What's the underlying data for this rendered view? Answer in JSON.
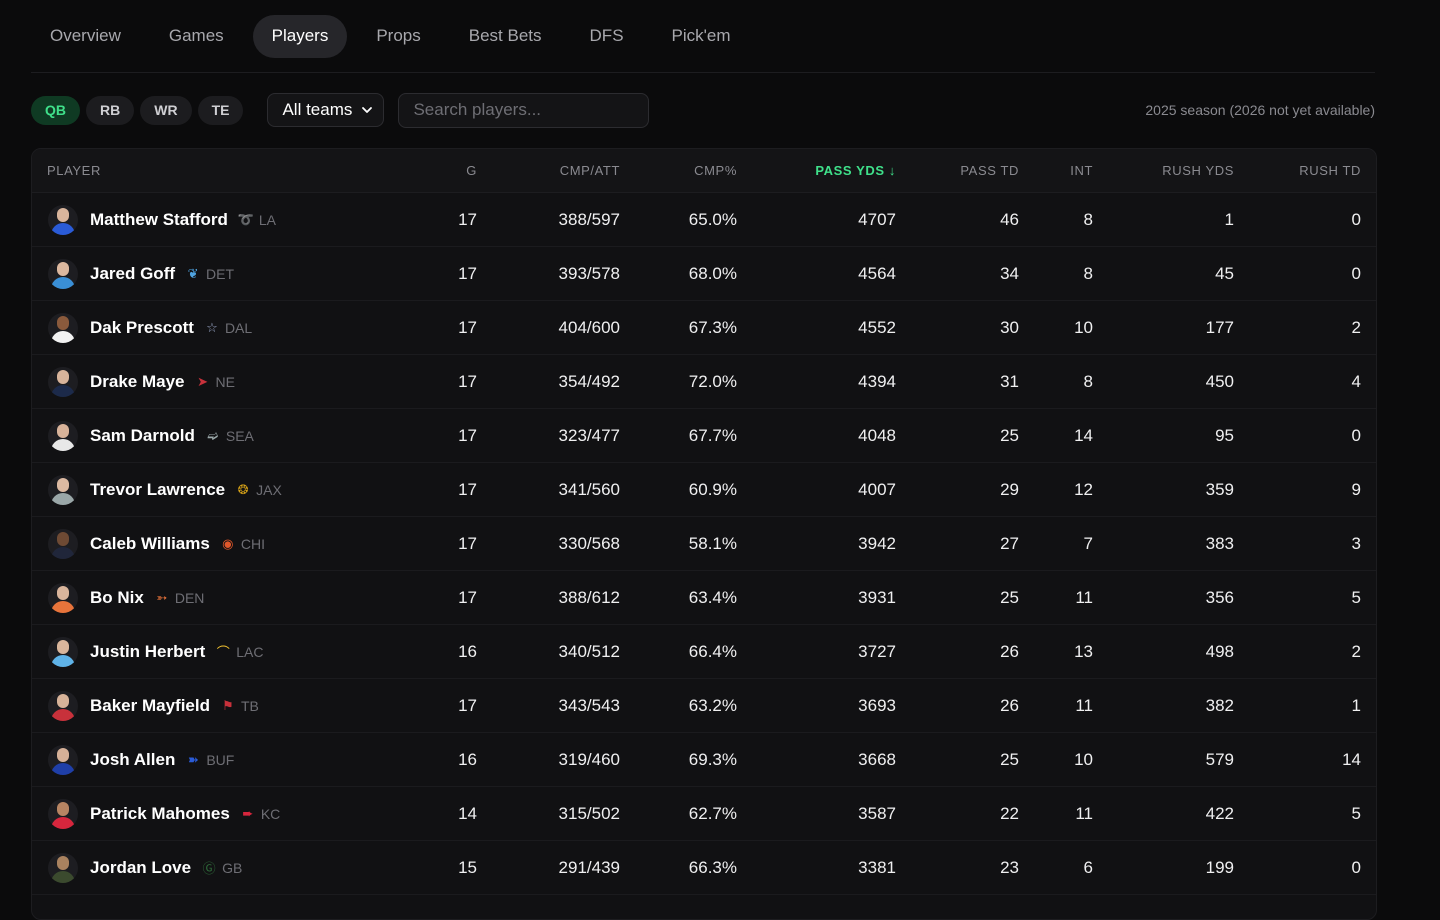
{
  "nav": {
    "tabs": [
      {
        "label": "Overview",
        "active": false
      },
      {
        "label": "Games",
        "active": false
      },
      {
        "label": "Players",
        "active": true
      },
      {
        "label": "Props",
        "active": false
      },
      {
        "label": "Best Bets",
        "active": false
      },
      {
        "label": "DFS",
        "active": false
      },
      {
        "label": "Pick'em",
        "active": false
      }
    ]
  },
  "filters": {
    "positions": [
      {
        "label": "QB",
        "active": true
      },
      {
        "label": "RB",
        "active": false
      },
      {
        "label": "WR",
        "active": false
      },
      {
        "label": "TE",
        "active": false
      }
    ],
    "team_select": "All teams",
    "search_placeholder": "Search players...",
    "season_note": "2025 season (2026 not yet available)"
  },
  "table": {
    "sort_indicator": "↓",
    "columns": [
      {
        "label": "PLAYER",
        "sorted": false
      },
      {
        "label": "G",
        "sorted": false
      },
      {
        "label": "CMP/ATT",
        "sorted": false
      },
      {
        "label": "CMP%",
        "sorted": false
      },
      {
        "label": "PASS YDS",
        "sorted": true
      },
      {
        "label": "PASS TD",
        "sorted": false
      },
      {
        "label": "INT",
        "sorted": false
      },
      {
        "label": "RUSH YDS",
        "sorted": false
      },
      {
        "label": "RUSH TD",
        "sorted": false
      }
    ],
    "rows": [
      {
        "name": "Matthew Stafford",
        "team": "LA",
        "logo": "ram-horn-icon",
        "color": "#2a5bd7",
        "skin": "#d9b59c",
        "g": "17",
        "cmp_att": "388/597",
        "cmp_pct": "65.0%",
        "pass_yds": "4707",
        "pass_td": "46",
        "int": "8",
        "rush_yds": "1",
        "rush_td": "0"
      },
      {
        "name": "Jared Goff",
        "team": "DET",
        "logo": "lion-icon",
        "color": "#3a8fd6",
        "skin": "#dcb89f",
        "g": "17",
        "cmp_att": "393/578",
        "cmp_pct": "68.0%",
        "pass_yds": "4564",
        "pass_td": "34",
        "int": "8",
        "rush_yds": "45",
        "rush_td": "0"
      },
      {
        "name": "Dak Prescott",
        "team": "DAL",
        "logo": "star-icon",
        "color": "#f2f2f2",
        "skin": "#8a5a3c",
        "g": "17",
        "cmp_att": "404/600",
        "cmp_pct": "67.3%",
        "pass_yds": "4552",
        "pass_td": "30",
        "int": "10",
        "rush_yds": "177",
        "rush_td": "2"
      },
      {
        "name": "Drake Maye",
        "team": "NE",
        "logo": "patriot-icon",
        "color": "#1c2a4a",
        "skin": "#d8b49b",
        "g": "17",
        "cmp_att": "354/492",
        "cmp_pct": "72.0%",
        "pass_yds": "4394",
        "pass_td": "31",
        "int": "8",
        "rush_yds": "450",
        "rush_td": "4"
      },
      {
        "name": "Sam Darnold",
        "team": "SEA",
        "logo": "seahawk-icon",
        "color": "#e8e8e8",
        "skin": "#d8b39a",
        "g": "17",
        "cmp_att": "323/477",
        "cmp_pct": "67.7%",
        "pass_yds": "4048",
        "pass_td": "25",
        "int": "14",
        "rush_yds": "95",
        "rush_td": "0"
      },
      {
        "name": "Trevor Lawrence",
        "team": "JAX",
        "logo": "jaguar-icon",
        "color": "#9aa7a8",
        "skin": "#dcbaa2",
        "g": "17",
        "cmp_att": "341/560",
        "cmp_pct": "60.9%",
        "pass_yds": "4007",
        "pass_td": "29",
        "int": "12",
        "rush_yds": "359",
        "rush_td": "9"
      },
      {
        "name": "Caleb Williams",
        "team": "CHI",
        "logo": "bear-icon",
        "color": "#20263a",
        "skin": "#6e4a34",
        "g": "17",
        "cmp_att": "330/568",
        "cmp_pct": "58.1%",
        "pass_yds": "3942",
        "pass_td": "27",
        "int": "7",
        "rush_yds": "383",
        "rush_td": "3"
      },
      {
        "name": "Bo Nix",
        "team": "DEN",
        "logo": "bronco-icon",
        "color": "#e8743b",
        "skin": "#d9b59c",
        "g": "17",
        "cmp_att": "388/612",
        "cmp_pct": "63.4%",
        "pass_yds": "3931",
        "pass_td": "25",
        "int": "11",
        "rush_yds": "356",
        "rush_td": "5"
      },
      {
        "name": "Justin Herbert",
        "team": "LAC",
        "logo": "bolt-icon",
        "color": "#5fb3e8",
        "skin": "#dab69c",
        "g": "16",
        "cmp_att": "340/512",
        "cmp_pct": "66.4%",
        "pass_yds": "3727",
        "pass_td": "26",
        "int": "13",
        "rush_yds": "498",
        "rush_td": "2"
      },
      {
        "name": "Baker Mayfield",
        "team": "TB",
        "logo": "buccaneer-flag-icon",
        "color": "#c8313b",
        "skin": "#d7b399",
        "g": "17",
        "cmp_att": "343/543",
        "cmp_pct": "63.2%",
        "pass_yds": "3693",
        "pass_td": "26",
        "int": "11",
        "rush_yds": "382",
        "rush_td": "1"
      },
      {
        "name": "Josh Allen",
        "team": "BUF",
        "logo": "buffalo-icon",
        "color": "#1f3fa8",
        "skin": "#d6b198",
        "g": "16",
        "cmp_att": "319/460",
        "cmp_pct": "69.3%",
        "pass_yds": "3668",
        "pass_td": "25",
        "int": "10",
        "rush_yds": "579",
        "rush_td": "14"
      },
      {
        "name": "Patrick Mahomes",
        "team": "KC",
        "logo": "arrowhead-icon",
        "color": "#d7263d",
        "skin": "#b88563",
        "g": "14",
        "cmp_att": "315/502",
        "cmp_pct": "62.7%",
        "pass_yds": "3587",
        "pass_td": "22",
        "int": "11",
        "rush_yds": "422",
        "rush_td": "5"
      },
      {
        "name": "Jordan Love",
        "team": "GB",
        "logo": "g-logo-icon",
        "color": "#3b4a2e",
        "skin": "#a9825f",
        "g": "15",
        "cmp_att": "291/439",
        "cmp_pct": "66.3%",
        "pass_yds": "3381",
        "pass_td": "23",
        "int": "6",
        "rush_yds": "199",
        "rush_td": "0"
      }
    ]
  },
  "team_logo_colors": {
    "LA": "#2a5bd7",
    "DET": "#4fa3e0",
    "DAL": "#9aa7c7",
    "NE": "#c8313b",
    "SEA": "#9aa7a8",
    "JAX": "#d4a017",
    "CHI": "#e0572b",
    "DEN": "#e8743b",
    "LAC": "#f2c230",
    "TB": "#c8313b",
    "BUF": "#2a5bd7",
    "KC": "#d7263d",
    "GB": "#2f6b3a"
  }
}
